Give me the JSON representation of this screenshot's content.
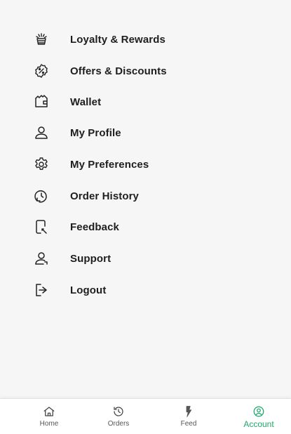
{
  "menu": {
    "items": [
      {
        "label": "Loyalty & Rewards",
        "icon": "loyalty-icon"
      },
      {
        "label": "Offers & Discounts",
        "icon": "discount-icon"
      },
      {
        "label": "Wallet",
        "icon": "wallet-icon"
      },
      {
        "label": "My Profile",
        "icon": "profile-icon"
      },
      {
        "label": "My Preferences",
        "icon": "gear-icon"
      },
      {
        "label": "Order History",
        "icon": "order-history-icon"
      },
      {
        "label": "Feedback",
        "icon": "feedback-icon"
      },
      {
        "label": "Support",
        "icon": "support-icon"
      },
      {
        "label": "Logout",
        "icon": "logout-icon"
      }
    ]
  },
  "tabbar": {
    "tabs": [
      {
        "label": "Home",
        "icon": "home-icon",
        "active": false
      },
      {
        "label": "Orders",
        "icon": "orders-icon",
        "active": false
      },
      {
        "label": "Feed",
        "icon": "feed-icon",
        "active": false
      },
      {
        "label": "Account",
        "icon": "account-icon",
        "active": true
      }
    ]
  },
  "colors": {
    "background": "#f6f6f7",
    "text": "#1e1e1e",
    "accent": "#1ea96a",
    "tab_inactive": "#555555"
  }
}
